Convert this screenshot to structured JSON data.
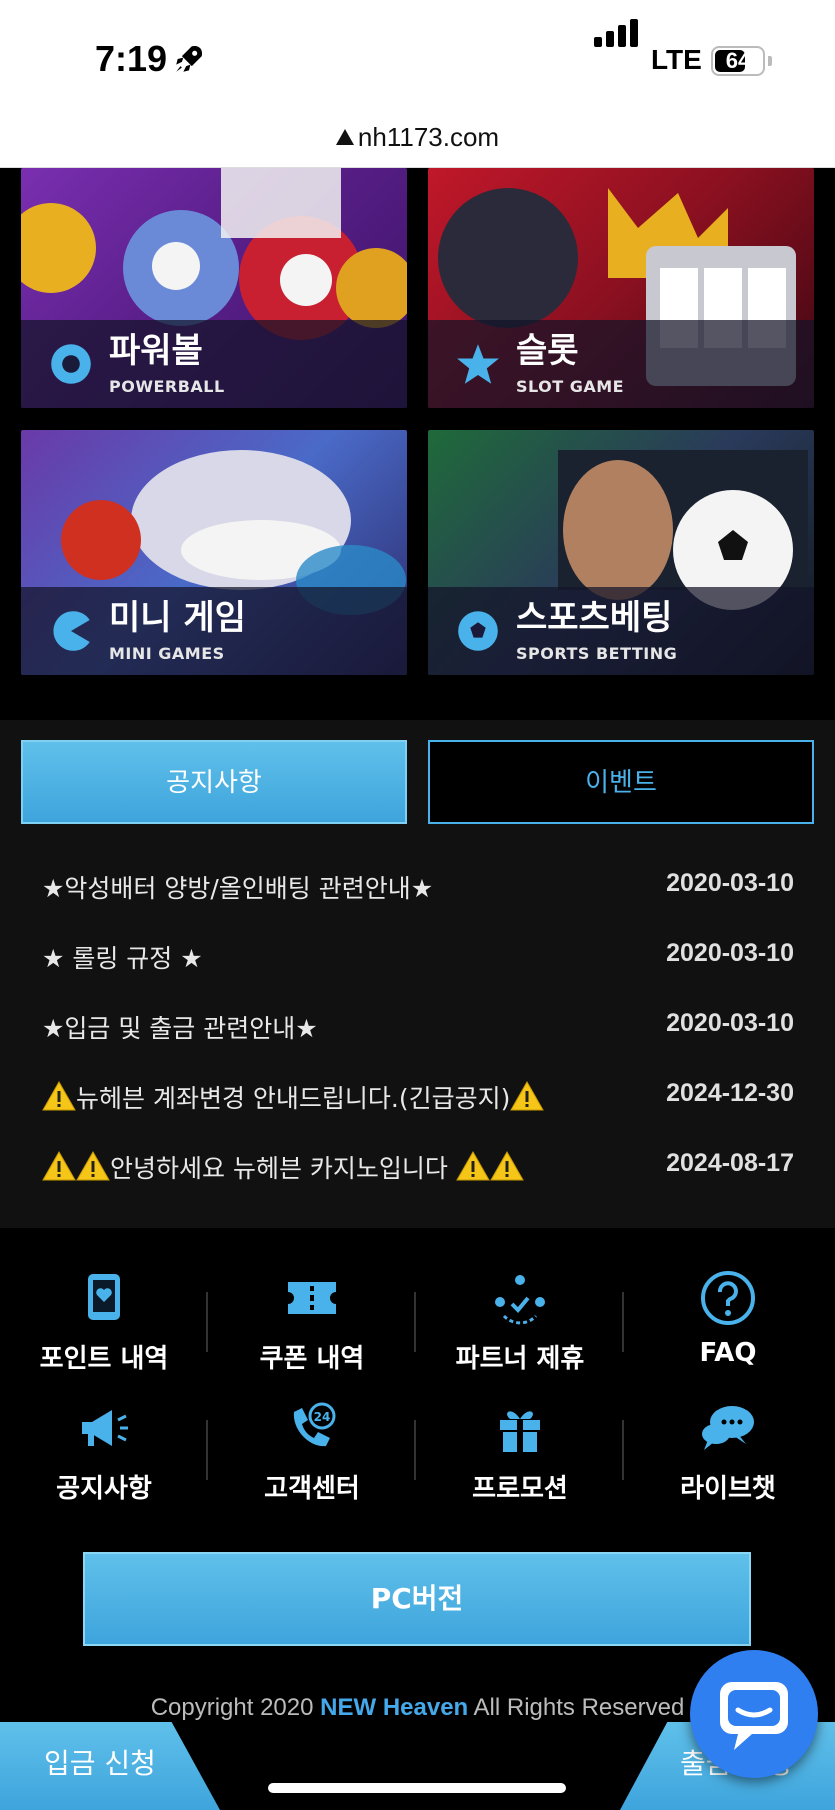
{
  "status_bar": {
    "time": "7:19",
    "network": "LTE",
    "battery": "64"
  },
  "browser": {
    "url": "nh1173.com"
  },
  "games": [
    {
      "title": "파워볼",
      "subtitle": "POWERBALL",
      "icon": "eight-ball-icon"
    },
    {
      "title": "슬롯",
      "subtitle": "SLOT GAME",
      "icon": "star-icon"
    },
    {
      "title": "미니 게임",
      "subtitle": "MINI GAMES",
      "icon": "pacman-icon"
    },
    {
      "title": "스포츠베팅",
      "subtitle": "SPORTS BETTING",
      "icon": "soccer-ball-icon"
    }
  ],
  "tabs": {
    "notice": "공지사항",
    "event": "이벤트"
  },
  "notices": [
    {
      "title": "★악성배터 양방/올인배팅 관련안내★",
      "date": "2020-03-10"
    },
    {
      "title": "★ 롤링 규정 ★",
      "date": "2020-03-10"
    },
    {
      "title": "★입금 및 출금 관련안내★",
      "date": "2020-03-10"
    },
    {
      "title": "뉴헤븐 계좌변경 안내드립니다.(긴급공지)",
      "date": "2024-12-30"
    },
    {
      "title": "안녕하세요 뉴헤븐 카지노입니다",
      "date": "2024-08-17"
    }
  ],
  "quick_menu": [
    {
      "label": "포인트 내역",
      "icon": "point-history-icon"
    },
    {
      "label": "쿠폰 내역",
      "icon": "coupon-icon"
    },
    {
      "label": "파트너 제휴",
      "icon": "partner-icon"
    },
    {
      "label": "FAQ",
      "icon": "question-icon"
    },
    {
      "label": "공지사항",
      "icon": "megaphone-icon"
    },
    {
      "label": "고객센터",
      "icon": "support-24-icon"
    },
    {
      "label": "프로모션",
      "icon": "gift-icon"
    },
    {
      "label": "라이브챗",
      "icon": "chat-bubbles-icon"
    }
  ],
  "pc_version": "PC버전",
  "footer": {
    "copyright_prefix": "Copyright 2020 ",
    "brand": "NEW Heaven",
    "copyright_suffix": " All Rights Reserved"
  },
  "bottom_bar": {
    "deposit": "입금 신청",
    "withdraw": "출금 신청"
  },
  "colors": {
    "accent": "#45a8e8",
    "panel": "#111111",
    "background": "#000000"
  }
}
